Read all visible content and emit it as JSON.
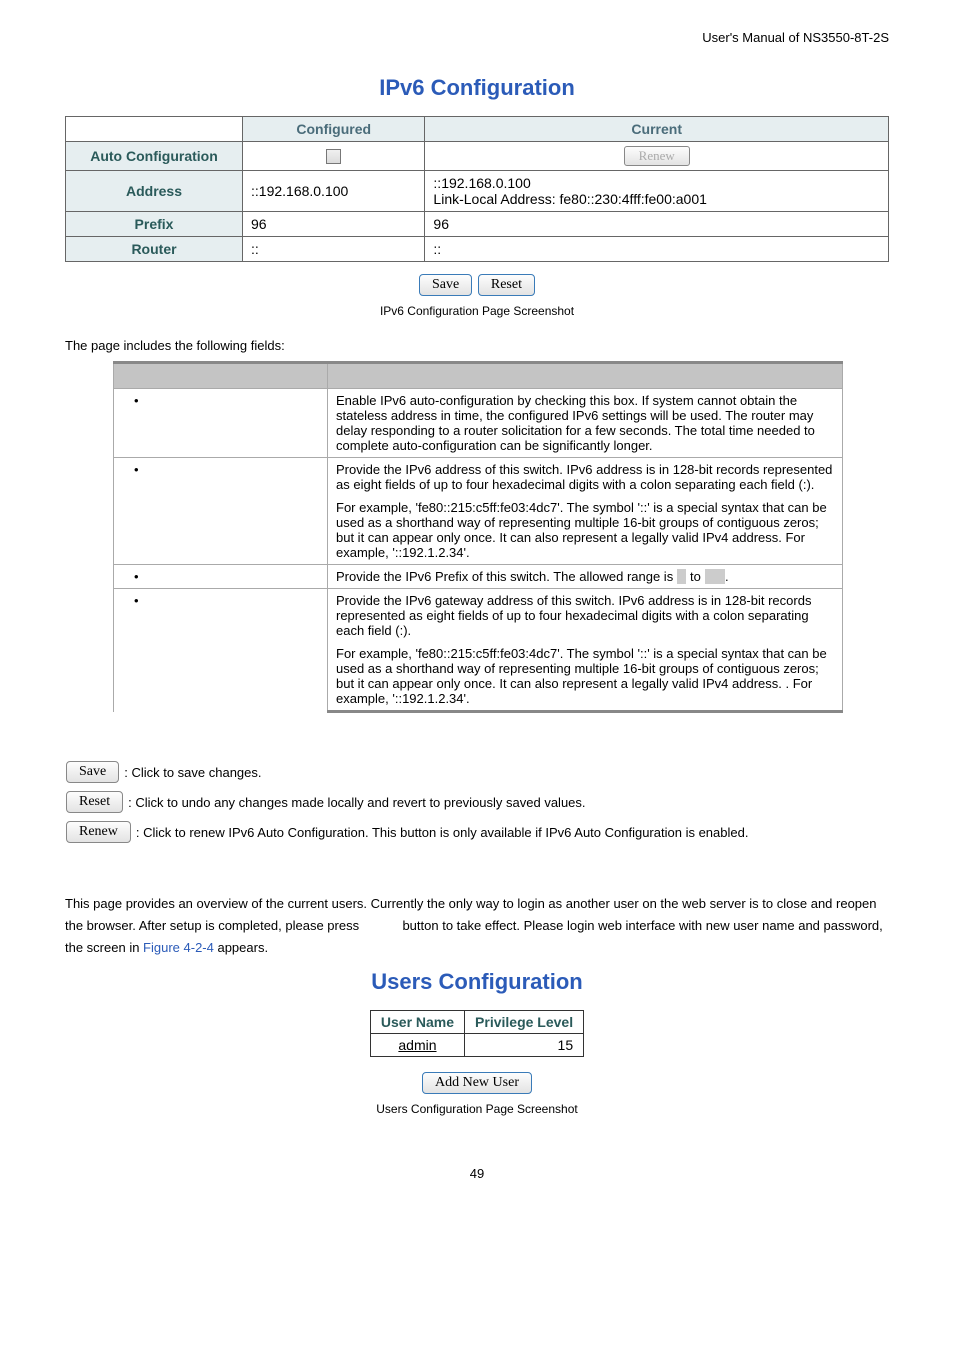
{
  "header": {
    "manual": "User's Manual of NS3550-8T-2S"
  },
  "ipv6": {
    "title": "IPv6 Configuration",
    "cols": {
      "configured": "Configured",
      "current": "Current"
    },
    "rows": {
      "auto": "Auto Configuration",
      "address": "Address",
      "prefix": "Prefix",
      "router": "Router"
    },
    "renew": "Renew",
    "values": {
      "addr_conf": "::192.168.0.100",
      "addr_cur1": "::192.168.0.100",
      "addr_cur2": "Link-Local Address: fe80::230:4fff:fe00:a001",
      "prefix_conf": "96",
      "prefix_cur": "96",
      "router_conf": "::",
      "router_cur": "::"
    },
    "buttons": {
      "save": "Save",
      "reset": "Reset"
    },
    "caption": "IPv6 Configuration Page Screenshot"
  },
  "fields": {
    "intro": "The page includes the following fields:",
    "r1": "Enable IPv6 auto-configuration by checking this box. If system cannot obtain the stateless address in time, the configured IPv6 settings will be used. The router may delay responding to a router solicitation for a few seconds. The total time needed to complete auto-configuration can be significantly longer.",
    "r2a": "Provide the IPv6 address of this switch. IPv6 address is in 128-bit records represented as eight fields of up to four hexadecimal digits with a colon separating each field (:).",
    "r2b": "For example, 'fe80::215:c5ff:fe03:4dc7'. The symbol '::' is a special syntax that can be used as a shorthand way of representing multiple 16-bit groups of contiguous zeros; but it can appear only once. It can also represent a legally valid IPv4 address. For example, '::192.1.2.34'.",
    "r3a": "Provide the IPv6 Prefix of this switch. The allowed range is ",
    "r3b": " to ",
    "r3c": ".",
    "r4a": "Provide the IPv6 gateway address of this switch. IPv6 address is in 128-bit records represented as eight fields of up to four hexadecimal digits with a colon separating each field (:).",
    "r4b": "For example, 'fe80::215:c5ff:fe03:4dc7'. The symbol '::' is a special syntax that can be used as a shorthand way of representing multiple 16-bit groups of contiguous zeros; but it can appear only once. It can also represent a legally valid IPv4 address. . For example, '::192.1.2.34'."
  },
  "btndesc": {
    "save": "Save",
    "savetxt": ": Click to save changes.",
    "reset": "Reset",
    "resettxt": ": Click to undo any changes made locally and revert to previously saved values.",
    "renew": "Renew",
    "renewtxt": ": Click to renew IPv6 Auto Configuration. This button is only available if IPv6 Auto Configuration is enabled."
  },
  "section": {
    "p1a": "This page provides an overview of the current users. Currently the only way to login as another user on the web server is to close and reopen the browser. After setup is completed, please press ",
    "p1b": " button to take effect. Please login web interface with new user name and password, the screen in ",
    "figref": "Figure 4-2-4",
    "p1c": " appears."
  },
  "users": {
    "title": "Users Configuration",
    "cols": {
      "name": "User Name",
      "priv": "Privilege Level"
    },
    "row": {
      "name": "admin",
      "priv": "15"
    },
    "add": "Add New User",
    "caption": "Users Configuration Page Screenshot"
  },
  "pagenum": "49"
}
